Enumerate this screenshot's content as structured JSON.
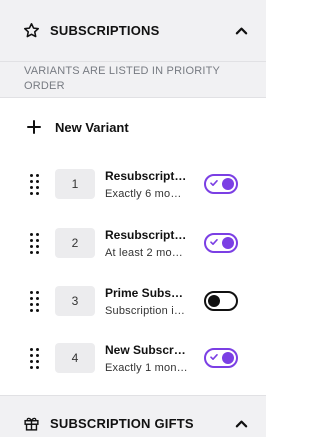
{
  "subscriptions_section": {
    "title": "SUBSCRIPTIONS",
    "icon": "star-icon",
    "expanded": true
  },
  "notice": "VARIANTS ARE LISTED IN PRIORITY ORDER",
  "new_variant": {
    "label": "New Variant",
    "icon": "plus-icon"
  },
  "variants": [
    {
      "order": "1",
      "name": "Resubscript…",
      "description": "Exactly 6 mo…",
      "enabled": true
    },
    {
      "order": "2",
      "name": "Resubscript…",
      "description": "At least 2 mo…",
      "enabled": true
    },
    {
      "order": "3",
      "name": "Prime Subs…",
      "description": "Subscription i…",
      "enabled": false
    },
    {
      "order": "4",
      "name": "New Subscr…",
      "description": "Exactly 1 mon…",
      "enabled": true
    }
  ],
  "gifts_section": {
    "title": "SUBSCRIPTION GIFTS",
    "icon": "gift-icon",
    "expanded": true
  },
  "colors": {
    "accent": "#7b3fe4",
    "header_bg": "#f1f1f3",
    "notice_text": "#777b82"
  }
}
